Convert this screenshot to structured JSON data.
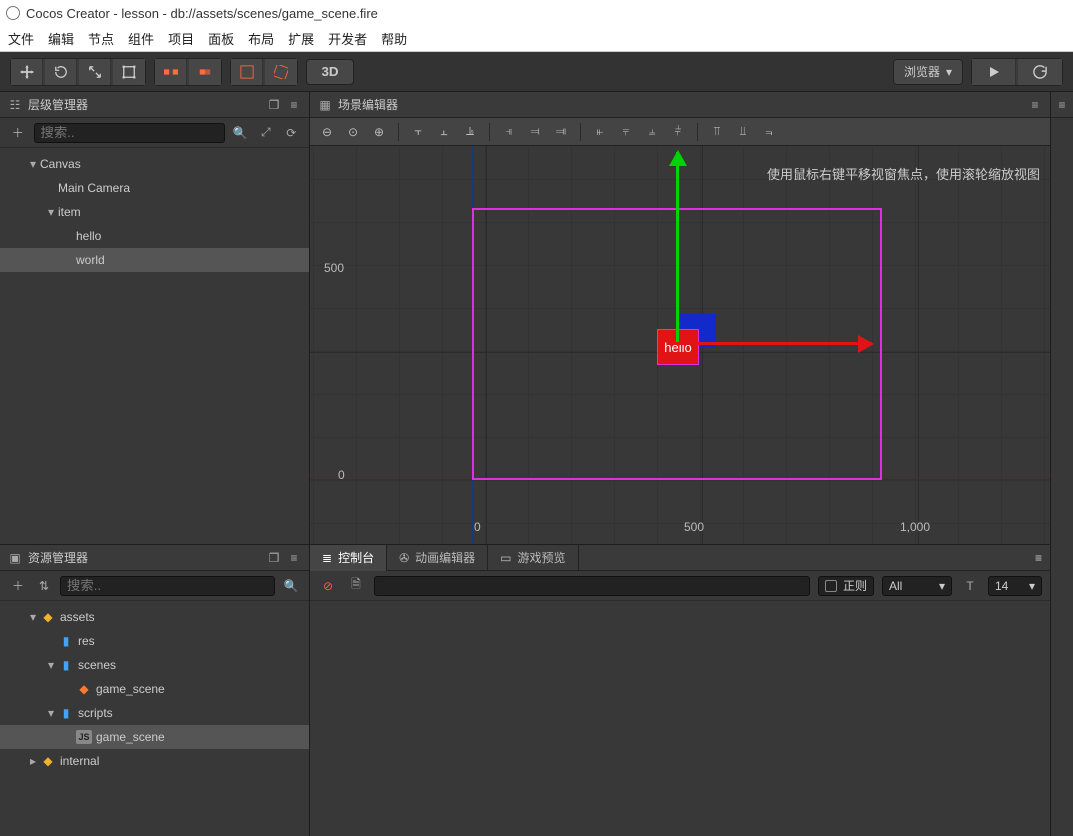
{
  "window": {
    "title": "Cocos Creator - lesson - db://assets/scenes/game_scene.fire"
  },
  "menu": [
    "文件",
    "编辑",
    "节点",
    "组件",
    "项目",
    "面板",
    "布局",
    "扩展",
    "开发者",
    "帮助"
  ],
  "toolbar": {
    "mode3d": "3D",
    "preview_target": "浏览器"
  },
  "panels": {
    "hierarchy": {
      "title": "层级管理器",
      "search_placeholder": "搜索..",
      "tree": [
        {
          "label": "Canvas",
          "depth": 0,
          "expanded": true
        },
        {
          "label": "Main Camera",
          "depth": 1,
          "expanded": null
        },
        {
          "label": "item",
          "depth": 1,
          "expanded": true
        },
        {
          "label": "hello",
          "depth": 2,
          "expanded": null
        },
        {
          "label": "world",
          "depth": 2,
          "expanded": null,
          "selected": true
        }
      ]
    },
    "assets": {
      "title": "资源管理器",
      "search_placeholder": "搜索..",
      "tree": [
        {
          "label": "assets",
          "depth": 0,
          "icon": "db",
          "expanded": true
        },
        {
          "label": "res",
          "depth": 1,
          "icon": "folder",
          "expanded": null
        },
        {
          "label": "scenes",
          "depth": 1,
          "icon": "folder",
          "expanded": true
        },
        {
          "label": "game_scene",
          "depth": 2,
          "icon": "fire",
          "expanded": null
        },
        {
          "label": "scripts",
          "depth": 1,
          "icon": "folder",
          "expanded": true
        },
        {
          "label": "game_scene",
          "depth": 2,
          "icon": "js",
          "expanded": null,
          "selected": true
        },
        {
          "label": "internal",
          "depth": 0,
          "icon": "db",
          "expanded": false
        }
      ]
    },
    "scene": {
      "title": "场景编辑器",
      "hint": "使用鼠标右键平移视窗焦点，使用滚轮缩放视图",
      "node_label": "hello",
      "ruler_y": [
        "500",
        "0"
      ],
      "ruler_x": [
        "0",
        "500",
        "1,000"
      ]
    },
    "bottom_tabs": {
      "console": "控制台",
      "anim": "动画编辑器",
      "preview": "游戏预览"
    },
    "console": {
      "regex_label": "正则",
      "filter_label": "All",
      "font_label": "14"
    }
  }
}
